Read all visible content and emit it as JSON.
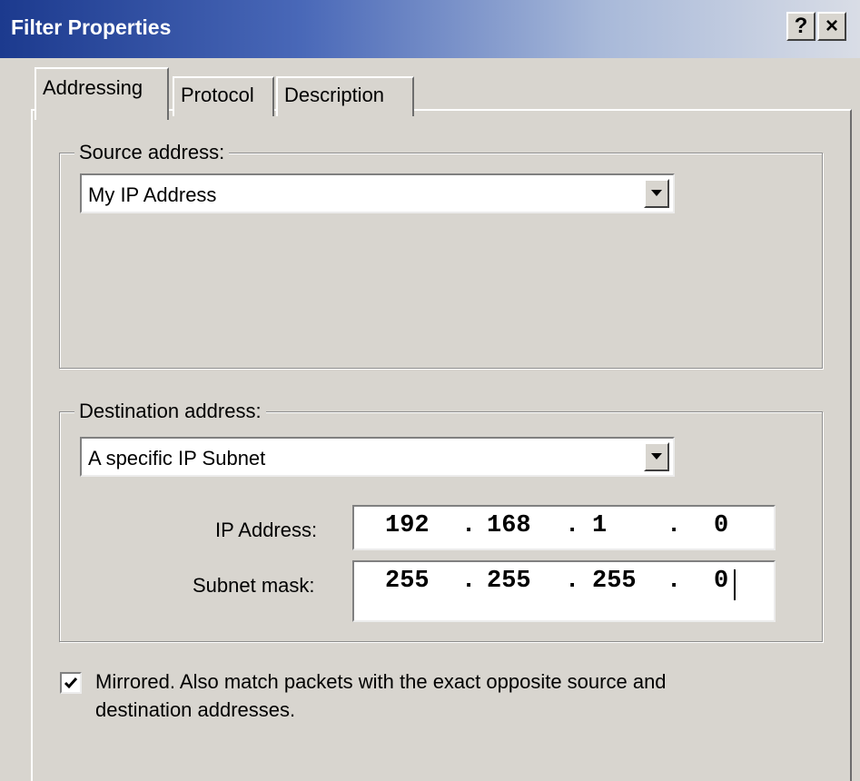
{
  "window": {
    "title": "Filter Properties",
    "help_button": "?",
    "close_button": "×"
  },
  "tabs": [
    {
      "label": "Addressing",
      "active": true
    },
    {
      "label": "Protocol",
      "active": false
    },
    {
      "label": "Description",
      "active": false
    }
  ],
  "source": {
    "group_label": "Source address:",
    "selected": "My IP Address"
  },
  "destination": {
    "group_label": "Destination address:",
    "selected": "A specific IP Subnet",
    "ip_label": "IP Address:",
    "ip": [
      "192",
      "168",
      "1",
      "0"
    ],
    "mask_label": "Subnet mask:",
    "mask": [
      "255",
      "255",
      "255",
      "0"
    ]
  },
  "mirrored": {
    "checked": true,
    "label": "Mirrored. Also match packets with the exact opposite source and destination addresses."
  },
  "colors": {
    "title_bar_start": "#1c3a8e",
    "title_bar_end": "#d9dde6",
    "dialog_bg": "#d8d5cf"
  },
  "icons": {
    "dropdown": "chevron-down-icon",
    "check": "checkmark-icon"
  }
}
